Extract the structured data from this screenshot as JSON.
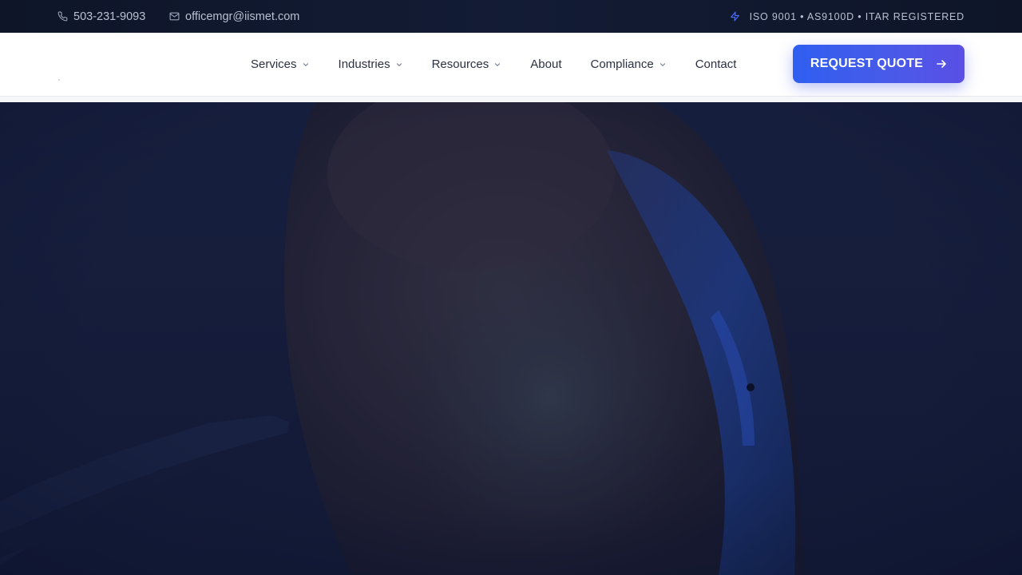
{
  "topbar": {
    "phone": "503-231-9093",
    "email": "officemgr@iismet.com",
    "certifications": "ISO 9001 • AS9100D • ITAR REGISTERED",
    "phone_icon": "phone-icon",
    "email_icon": "mail-icon",
    "cert_icon": "lightning-icon"
  },
  "nav": {
    "items": [
      {
        "label": "Services",
        "has_dropdown": true
      },
      {
        "label": "Industries",
        "has_dropdown": true
      },
      {
        "label": "Resources",
        "has_dropdown": true
      },
      {
        "label": "About",
        "has_dropdown": false
      },
      {
        "label": "Compliance",
        "has_dropdown": true
      },
      {
        "label": "Contact",
        "has_dropdown": false
      }
    ],
    "cta_label": "REQUEST QUOTE",
    "cta_icon": "arrow-right-icon"
  },
  "hero": {
    "image": "bird-on-branch-photo"
  },
  "colors": {
    "topbar_bg": "#111a31",
    "accent": "#3b5bea",
    "nav_text": "#2a3142",
    "hero_overlay": "#121b38"
  }
}
